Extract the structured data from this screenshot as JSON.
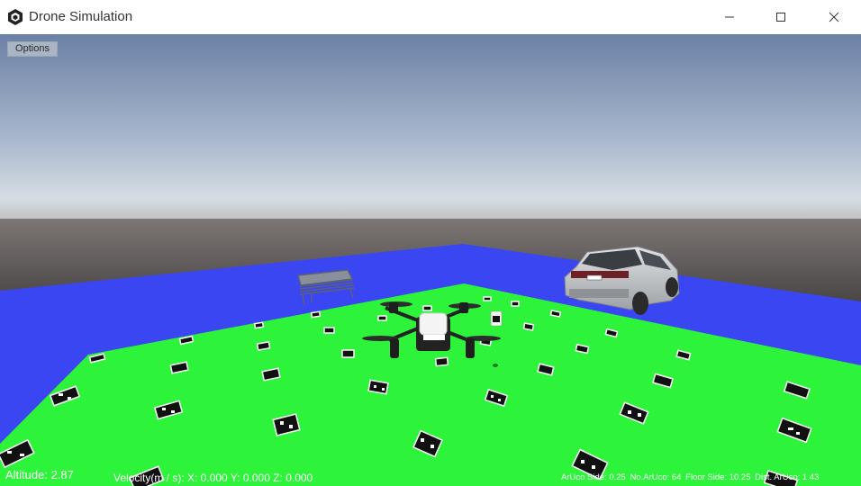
{
  "window": {
    "title": "Drone Simulation",
    "icon": "unity-logo-icon",
    "controls": [
      "minimize-icon",
      "maximize-icon",
      "close-icon"
    ]
  },
  "viewport": {
    "options_label": "Options",
    "hud": {
      "altitude": "Altitude: 2.87",
      "velocity": "Velocity(m / s):  X: 0.000 Y: 0.000 Z: 0.000",
      "aruco_side": "ArUco Side: 0.25",
      "no_aruco": "No.ArUco: 64",
      "floor_side": "Floor Side: 10.25",
      "dist_aruco": "Dist. ArUco: 1.43"
    },
    "colors": {
      "sky_top": "#6f83a8",
      "sky_horizon": "#c8d3df",
      "ground": "#4a4747",
      "blue_floor": "#3a47f2",
      "green_floor": "#2bf53a"
    }
  }
}
